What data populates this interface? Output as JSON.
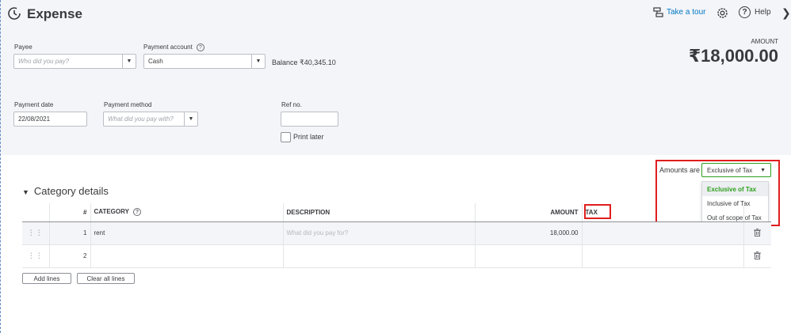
{
  "header": {
    "title": "Expense",
    "tour_label": "Take a tour",
    "help_label": "Help"
  },
  "payee": {
    "label": "Payee",
    "placeholder": "Who did you pay?"
  },
  "payment_account": {
    "label": "Payment account",
    "value": "Cash",
    "balance": "Balance ₹40,345.10"
  },
  "amount": {
    "label": "AMOUNT",
    "value": "₹18,000.00"
  },
  "payment_date": {
    "label": "Payment date",
    "value": "22/08/2021"
  },
  "payment_method": {
    "label": "Payment method",
    "placeholder": "What did you pay with?"
  },
  "ref_no": {
    "label": "Ref no.",
    "value": ""
  },
  "print_later": {
    "label": "Print later",
    "checked": false
  },
  "amounts_are": {
    "label": "Amounts are",
    "selected": "Exclusive of Tax",
    "options": [
      "Exclusive of Tax",
      "Inclusive of Tax",
      "Out of scope of Tax"
    ]
  },
  "category_details": {
    "title": "Category details",
    "columns": [
      "#",
      "CATEGORY",
      "DESCRIPTION",
      "AMOUNT",
      "TAX"
    ],
    "rows": [
      {
        "num": "1",
        "category": "rent",
        "description_placeholder": "What did you pay for?",
        "amount": "18,000.00",
        "tax": ""
      },
      {
        "num": "2",
        "category": "",
        "description_placeholder": "",
        "amount": "",
        "tax": ""
      }
    ],
    "add_lines_label": "Add lines",
    "clear_lines_label": "Clear all lines"
  },
  "colors": {
    "accent_green": "#2ca01c",
    "link_blue": "#0077c5",
    "highlight_red": "#e01e1e"
  }
}
